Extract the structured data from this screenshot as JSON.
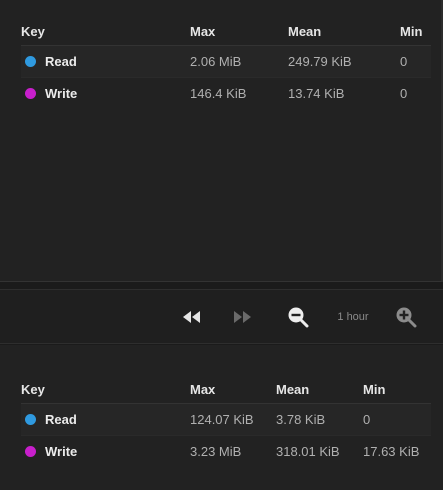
{
  "top_legend": {
    "headers": {
      "key": "Key",
      "max": "Max",
      "mean": "Mean",
      "min": "Min"
    },
    "rows": [
      {
        "key": "Read",
        "color": "#2f9ae0",
        "max": "2.06 MiB",
        "mean": "249.79 KiB",
        "min": "0"
      },
      {
        "key": "Write",
        "color": "#c81fcc",
        "max": "146.4 KiB",
        "mean": "13.74 KiB",
        "min": "0"
      }
    ]
  },
  "toolbar": {
    "rewind_icon": "rewind-icon",
    "forward_icon": "fast-forward-icon",
    "zoom_out_icon": "zoom-out-icon",
    "zoom_label": "1 hour",
    "zoom_in_icon": "zoom-in-icon"
  },
  "bottom_legend": {
    "headers": {
      "key": "Key",
      "max": "Max",
      "mean": "Mean",
      "min": "Min"
    },
    "rows": [
      {
        "key": "Read",
        "color": "#2f9ae0",
        "max": "124.07 KiB",
        "mean": "3.78 KiB",
        "min": "0"
      },
      {
        "key": "Write",
        "color": "#c81fcc",
        "max": "3.23 MiB",
        "mean": "318.01 KiB",
        "min": "17.63 KiB"
      }
    ]
  }
}
